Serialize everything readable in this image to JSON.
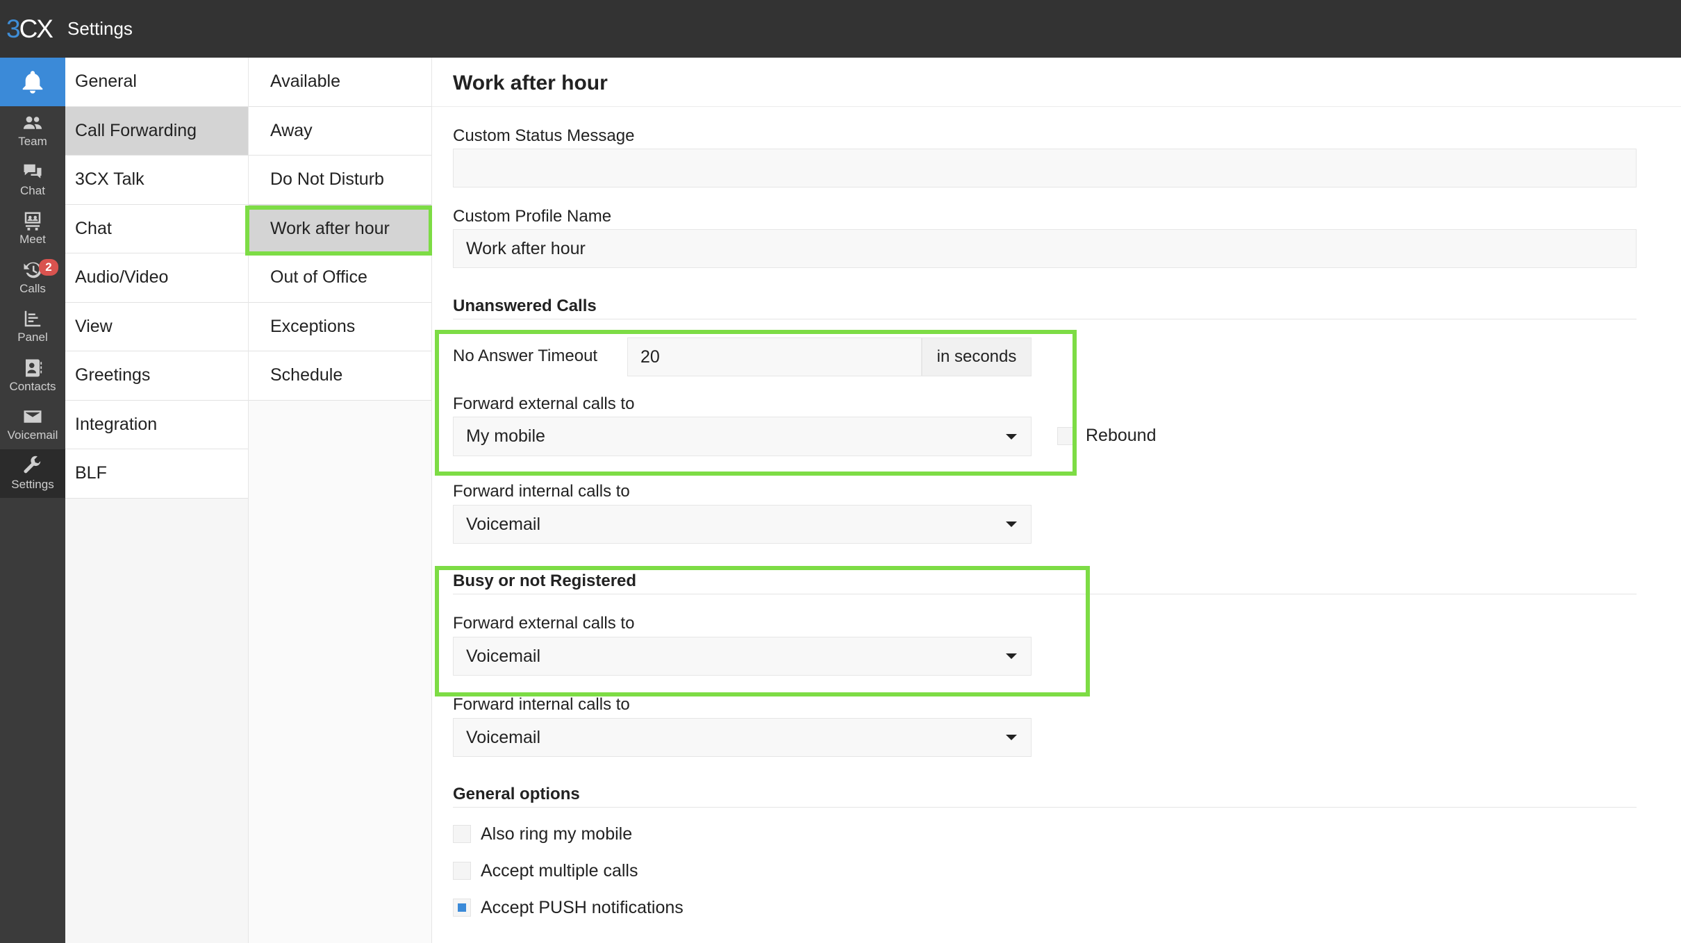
{
  "topbar": {
    "logo_a": "3",
    "logo_b": "CX",
    "title": "Settings"
  },
  "rail": {
    "items": [
      {
        "label": "",
        "icon": "bell-icon"
      },
      {
        "label": "Team",
        "icon": "team-icon"
      },
      {
        "label": "Chat",
        "icon": "chat-icon"
      },
      {
        "label": "Meet",
        "icon": "meet-icon"
      },
      {
        "label": "Calls",
        "icon": "history-icon",
        "badge": "2"
      },
      {
        "label": "Panel",
        "icon": "panel-icon"
      },
      {
        "label": "Contacts",
        "icon": "contacts-icon"
      },
      {
        "label": "Voicemail",
        "icon": "voicemail-icon"
      },
      {
        "label": "Settings",
        "icon": "wrench-icon"
      }
    ]
  },
  "settings_menu": [
    "General",
    "Call Forwarding",
    "3CX Talk",
    "Chat",
    "Audio/Video",
    "View",
    "Greetings",
    "Integration",
    "BLF"
  ],
  "profiles_menu": [
    "Available",
    "Away",
    "Do Not Disturb",
    "Work after hour",
    "Out of Office",
    "Exceptions",
    "Schedule"
  ],
  "main": {
    "title": "Work after hour",
    "custom_status_label": "Custom Status Message",
    "custom_status_value": "",
    "custom_profile_label": "Custom Profile Name",
    "custom_profile_value": "Work after hour",
    "unanswered": {
      "heading": "Unanswered Calls",
      "timeout_label": "No Answer Timeout",
      "timeout_value": "20",
      "timeout_unit": "in seconds",
      "ext_label": "Forward external calls to",
      "ext_value": "My mobile",
      "rebound_label": "Rebound",
      "int_label": "Forward internal calls to",
      "int_value": "Voicemail"
    },
    "busy": {
      "heading": "Busy or not Registered",
      "ext_label": "Forward external calls to",
      "ext_value": "Voicemail",
      "int_label": "Forward internal calls to",
      "int_value": "Voicemail"
    },
    "general": {
      "heading": "General options",
      "opt1": "Also ring my mobile",
      "opt2": "Accept multiple calls",
      "opt3": "Accept PUSH notifications"
    }
  },
  "colors": {
    "accent": "#3b8ad8",
    "highlight": "#7ddc45",
    "topbar": "#333333",
    "badge": "#d9534f"
  }
}
